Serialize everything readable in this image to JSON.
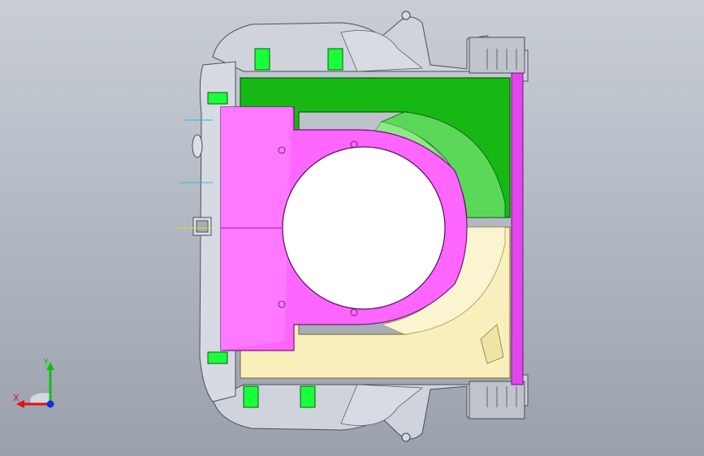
{
  "viewport": {
    "background": "#b4bac4"
  },
  "colors": {
    "green_face": "#17b814",
    "green_dark": "#0f8f10",
    "magenta_face": "#ff66ff",
    "magenta_inner": "#e040ee",
    "cream_face": "#f8efbc",
    "cream_edge": "#d8cc8e",
    "gray_body": "#c8ccd6",
    "gray_dark": "#6e7380",
    "pad_green": "#19ff3a"
  },
  "triad": {
    "x_label": "X",
    "y_label": "Y",
    "x_color": "#e01010",
    "y_color": "#12c012",
    "z_color": "#1030e0"
  },
  "icons": {
    "triad": "coordinate-triad-icon",
    "hole": "circular-hole"
  }
}
